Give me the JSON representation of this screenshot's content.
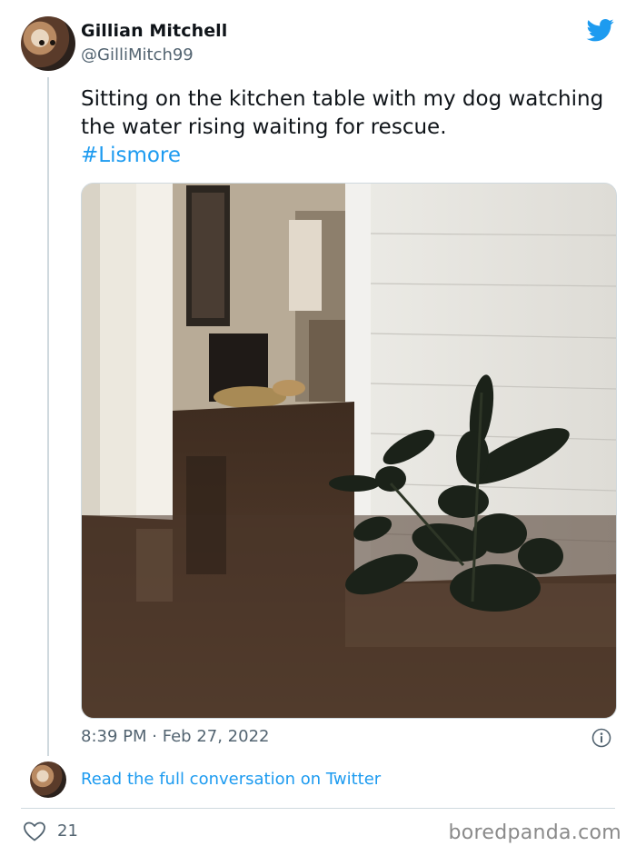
{
  "author": {
    "name": "Gillian Mitchell",
    "handle": "@GilliMitch99",
    "avatar_icon": "avatar-dog-photo"
  },
  "tweet": {
    "text": "Sitting on the kitchen table with my dog watching the water rising waiting for rescue.",
    "hashtag": "#Lismore",
    "media_icon": "flooded-room-photo",
    "time": "8:39 PM",
    "separator": "·",
    "date": "Feb 27, 2022"
  },
  "conversation": {
    "link_text": "Read the full conversation on Twitter"
  },
  "engagement": {
    "likes": "21"
  },
  "watermark": {
    "text": "boredpanda.com"
  },
  "colors": {
    "brand": "#1d9bf0",
    "text": "#0f1419",
    "secondary": "#536471",
    "divider": "#cfd9de"
  },
  "icons": {
    "brand": "twitter-bird-icon",
    "info": "info-icon",
    "like": "heart-icon"
  }
}
